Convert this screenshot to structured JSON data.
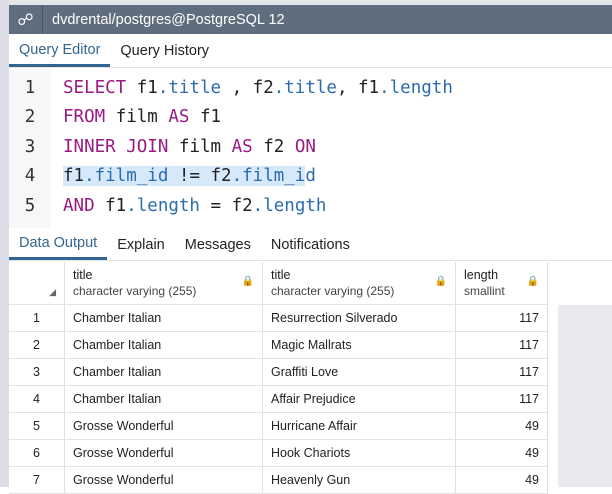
{
  "window": {
    "title": "dvdrental/postgres@PostgreSQL 12",
    "icon": "connection-icon"
  },
  "editor_tabs": [
    "Query Editor",
    "Query History"
  ],
  "editor": {
    "lines": [
      [
        {
          "t": "SELECT",
          "c": "kw"
        },
        {
          "t": " f1",
          "c": ""
        },
        {
          "t": ".title",
          "c": "pr"
        },
        {
          "t": " , f2",
          "c": ""
        },
        {
          "t": ".title",
          "c": "pr"
        },
        {
          "t": ", f1",
          "c": ""
        },
        {
          "t": ".length",
          "c": "pr"
        }
      ],
      [
        {
          "t": "FROM",
          "c": "kw"
        },
        {
          "t": " film ",
          "c": ""
        },
        {
          "t": "AS",
          "c": "kw"
        },
        {
          "t": " f1",
          "c": ""
        }
      ],
      [
        {
          "t": "INNER JOIN",
          "c": "kw"
        },
        {
          "t": " film ",
          "c": ""
        },
        {
          "t": "AS",
          "c": "kw"
        },
        {
          "t": " f2 ",
          "c": ""
        },
        {
          "t": "ON",
          "c": "kw"
        }
      ],
      [
        {
          "t": "f1",
          "c": "hl"
        },
        {
          "t": ".film_id",
          "c": "pr hl"
        },
        {
          "t": " != f2",
          "c": "hl"
        },
        {
          "t": ".film_i",
          "c": "pr hl"
        },
        {
          "t": "d",
          "c": "pr"
        }
      ],
      [
        {
          "t": "AND",
          "c": "kw"
        },
        {
          "t": " f1",
          "c": ""
        },
        {
          "t": ".length",
          "c": "pr"
        },
        {
          "t": " = f2",
          "c": ""
        },
        {
          "t": ".length",
          "c": "pr"
        }
      ]
    ]
  },
  "output_tabs": [
    "Data Output",
    "Explain",
    "Messages",
    "Notifications"
  ],
  "table": {
    "columns": [
      {
        "name": "title",
        "type": "character varying (255)"
      },
      {
        "name": "title",
        "type": "character varying (255)"
      },
      {
        "name": "length",
        "type": "smallint"
      }
    ],
    "rows": [
      [
        "1",
        "Chamber Italian",
        "Resurrection Silverado",
        "117"
      ],
      [
        "2",
        "Chamber Italian",
        "Magic Mallrats",
        "117"
      ],
      [
        "3",
        "Chamber Italian",
        "Graffiti Love",
        "117"
      ],
      [
        "4",
        "Chamber Italian",
        "Affair Prejudice",
        "117"
      ],
      [
        "5",
        "Grosse Wonderful",
        "Hurricane Affair",
        "49"
      ],
      [
        "6",
        "Grosse Wonderful",
        "Hook Chariots",
        "49"
      ],
      [
        "7",
        "Grosse Wonderful",
        "Heavenly Gun",
        "49"
      ]
    ]
  }
}
